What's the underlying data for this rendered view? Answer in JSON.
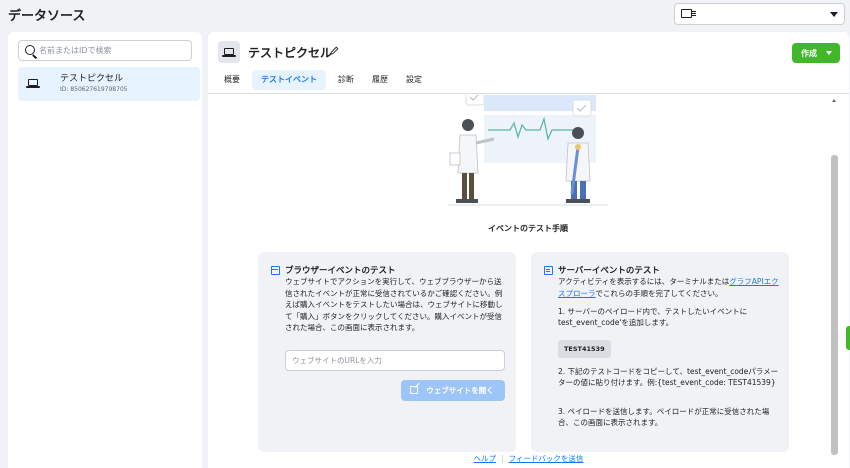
{
  "header": {
    "title": "データソース"
  },
  "sidebar": {
    "search_placeholder": "名前またはIDで検索",
    "sources": [
      {
        "name": "テストピクセル",
        "id_label": "ID: 850627619798705"
      }
    ]
  },
  "panel": {
    "title": "テストピクセル",
    "create_label": "作成",
    "tabs": [
      {
        "label": "概要",
        "active": false
      },
      {
        "label": "テストイベント",
        "active": true
      },
      {
        "label": "診断",
        "active": false
      },
      {
        "label": "履歴",
        "active": false
      },
      {
        "label": "設定",
        "active": false
      }
    ]
  },
  "content": {
    "steps_heading": "イベントのテスト手順",
    "browser": {
      "title": "ブラウザーイベントのテスト",
      "body": "ウェブサイトでアクションを実行して、ウェブブラウザーから送信されたイベントが正常に受信されているかご確認ください。例えば購入イベントをテストしたい場合は、ウェブサイトに移動して「購入」ボタンをクリックしてください。購入イベントが受信された場合、この画面に表示されます。",
      "url_placeholder": "ウェブサイトのURLを入力",
      "open_button": "ウェブサイトを開く"
    },
    "server": {
      "title": "サーバーイベントのテスト",
      "intro_before": "アクティビティを表示するには、ターミナルまたは",
      "intro_link": "グラフAPIエクスプローラ",
      "intro_after": "でこれらの手順を完了してください。",
      "step1": "1. サーバーのペイロード内で、テストしたいイベントにtest_event_code'を追加します。",
      "test_code": "TEST41539",
      "step2": "2. 下記のテストコードをコピーして、test_event_codeパラメーターの値に貼り付けます。例:{test_event_code: TEST41539}",
      "step3": "3. ペイロードを送信します。ペイロードが正常に受信された場合、この画面に表示されます。"
    },
    "footer": {
      "help": "ヘルプ",
      "separator": "|",
      "feedback": "フィードバックを送信"
    }
  },
  "colors": {
    "accent": "#1877f2",
    "create_green": "#42b72a",
    "selected_bg": "#e7f3ff",
    "page_bg": "#f0f2f5"
  }
}
